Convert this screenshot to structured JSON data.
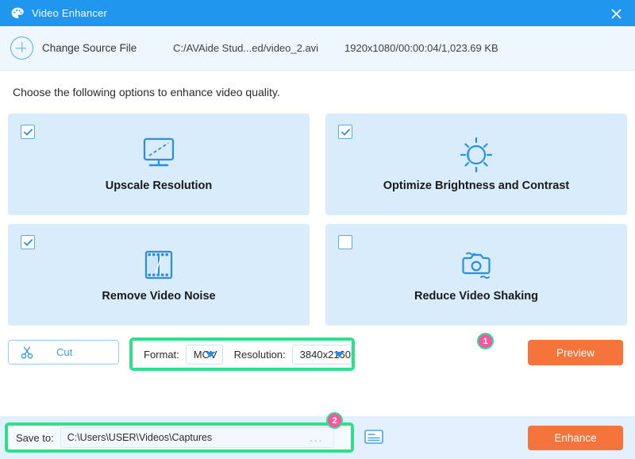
{
  "window": {
    "title": "Video Enhancer",
    "app_icon": "palette-icon",
    "close_icon": "close-icon",
    "titlebar_color": "#2196ef"
  },
  "source_bar": {
    "add_icon": "plus-circle-icon",
    "change_source_label": "Change Source File",
    "file_path": "C:/AVAide Stud...ed/video_2.avi",
    "file_meta": "1920x1080/00:00:04/1,023.69 KB"
  },
  "instruction": "Choose the following options to enhance video quality.",
  "options": [
    {
      "label": "Upscale Resolution",
      "checked": "checked",
      "icon": "monitor-upscale-icon"
    },
    {
      "label": "Optimize Brightness and Contrast",
      "checked": "checked",
      "icon": "sun-brightness-icon"
    },
    {
      "label": "Remove Video Noise",
      "checked": "checked",
      "icon": "film-strip-icon"
    },
    {
      "label": "Reduce Video Shaking",
      "checked": "unchecked",
      "icon": "camera-stabilize-icon"
    }
  ],
  "controls": {
    "cut_label": "Cut",
    "cut_icon": "scissors-icon",
    "format_label": "Format:",
    "format_value": "MOV",
    "resolution_label": "Resolution:",
    "resolution_value": "3840x2160",
    "preview_label": "Preview",
    "badge_1": "1"
  },
  "bottom_bar": {
    "save_to_label": "Save to:",
    "save_path": "C:\\Users\\USER\\Videos\\Captures",
    "browse_label": "...",
    "folder_icon": "folder-open-icon",
    "enhance_label": "Enhance",
    "badge_2": "2"
  },
  "colors": {
    "accent_blue": "#2196ef",
    "card_bg": "#d8ecfb",
    "action_orange": "#f4743b",
    "highlight_green": "#2fe08a",
    "badge_pink": "#f7579f"
  }
}
